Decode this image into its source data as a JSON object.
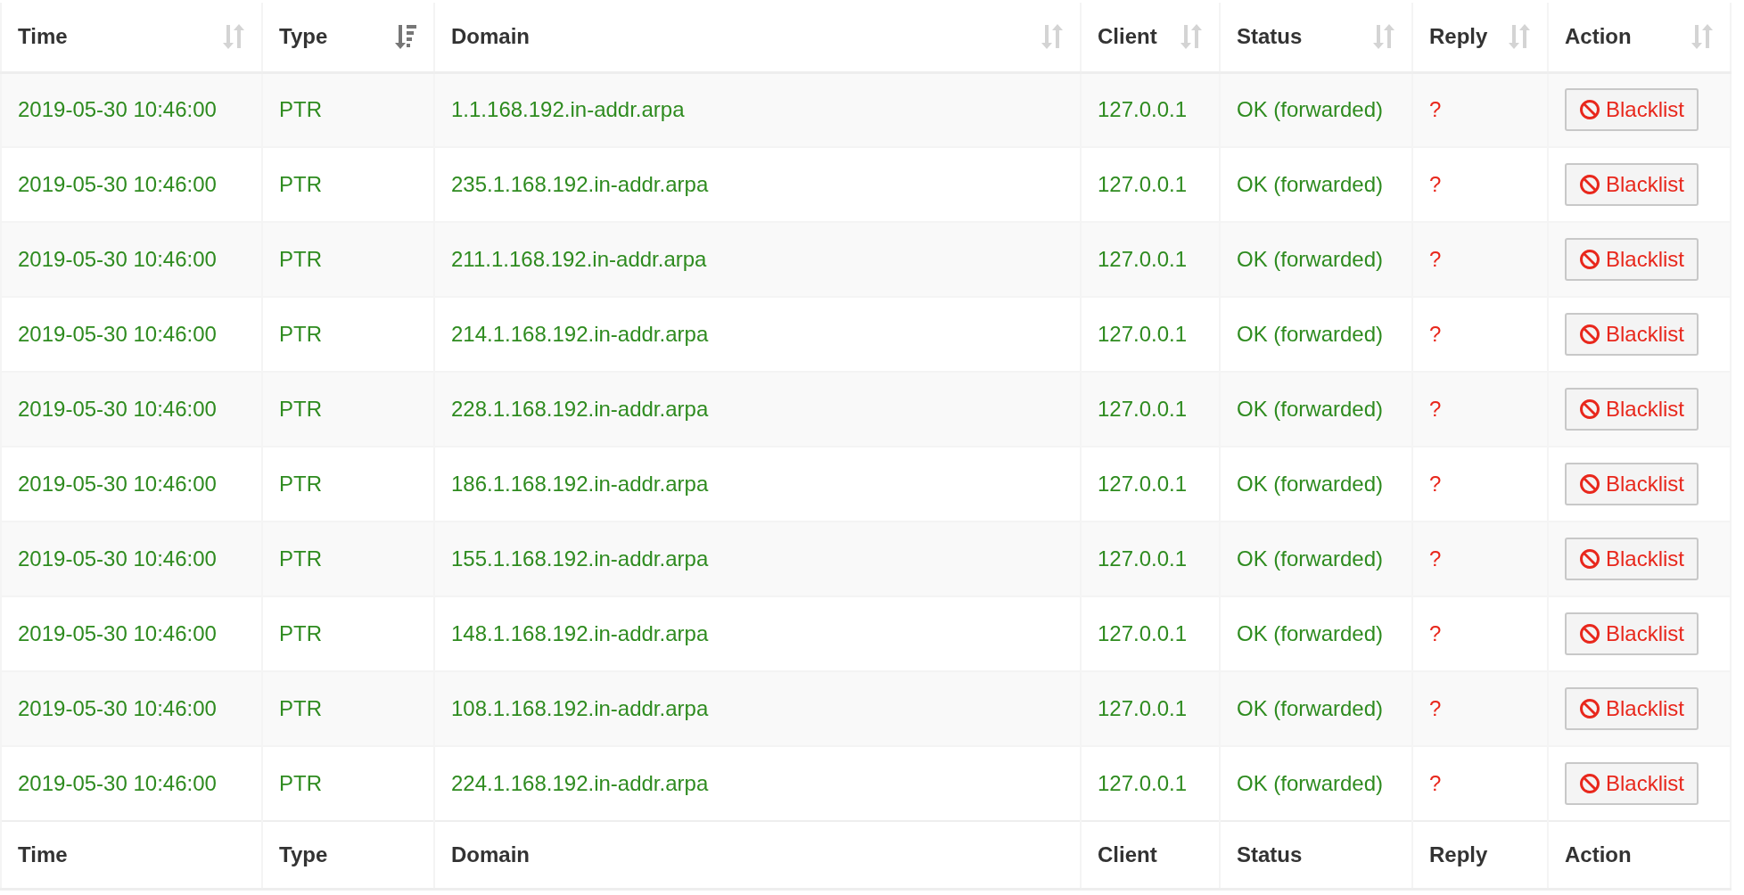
{
  "columns": [
    {
      "label": "Time",
      "sorted": false
    },
    {
      "label": "Type",
      "sorted": true
    },
    {
      "label": "Domain",
      "sorted": false
    },
    {
      "label": "Client",
      "sorted": false
    },
    {
      "label": "Status",
      "sorted": false
    },
    {
      "label": "Reply",
      "sorted": false
    },
    {
      "label": "Action",
      "sorted": false
    }
  ],
  "rows": [
    {
      "time": "2019-05-30 10:46:00",
      "type": "PTR",
      "domain": "1.1.168.192.in-addr.arpa",
      "client": "127.0.0.1",
      "status": "OK (forwarded)",
      "reply": "?",
      "action": "Blacklist"
    },
    {
      "time": "2019-05-30 10:46:00",
      "type": "PTR",
      "domain": "235.1.168.192.in-addr.arpa",
      "client": "127.0.0.1",
      "status": "OK (forwarded)",
      "reply": "?",
      "action": "Blacklist"
    },
    {
      "time": "2019-05-30 10:46:00",
      "type": "PTR",
      "domain": "211.1.168.192.in-addr.arpa",
      "client": "127.0.0.1",
      "status": "OK (forwarded)",
      "reply": "?",
      "action": "Blacklist"
    },
    {
      "time": "2019-05-30 10:46:00",
      "type": "PTR",
      "domain": "214.1.168.192.in-addr.arpa",
      "client": "127.0.0.1",
      "status": "OK (forwarded)",
      "reply": "?",
      "action": "Blacklist"
    },
    {
      "time": "2019-05-30 10:46:00",
      "type": "PTR",
      "domain": "228.1.168.192.in-addr.arpa",
      "client": "127.0.0.1",
      "status": "OK (forwarded)",
      "reply": "?",
      "action": "Blacklist"
    },
    {
      "time": "2019-05-30 10:46:00",
      "type": "PTR",
      "domain": "186.1.168.192.in-addr.arpa",
      "client": "127.0.0.1",
      "status": "OK (forwarded)",
      "reply": "?",
      "action": "Blacklist"
    },
    {
      "time": "2019-05-30 10:46:00",
      "type": "PTR",
      "domain": "155.1.168.192.in-addr.arpa",
      "client": "127.0.0.1",
      "status": "OK (forwarded)",
      "reply": "?",
      "action": "Blacklist"
    },
    {
      "time": "2019-05-30 10:46:00",
      "type": "PTR",
      "domain": "148.1.168.192.in-addr.arpa",
      "client": "127.0.0.1",
      "status": "OK (forwarded)",
      "reply": "?",
      "action": "Blacklist"
    },
    {
      "time": "2019-05-30 10:46:00",
      "type": "PTR",
      "domain": "108.1.168.192.in-addr.arpa",
      "client": "127.0.0.1",
      "status": "OK (forwarded)",
      "reply": "?",
      "action": "Blacklist"
    },
    {
      "time": "2019-05-30 10:46:00",
      "type": "PTR",
      "domain": "224.1.168.192.in-addr.arpa",
      "client": "127.0.0.1",
      "status": "OK (forwarded)",
      "reply": "?",
      "action": "Blacklist"
    }
  ],
  "footer": [
    "Time",
    "Type",
    "Domain",
    "Client",
    "Status",
    "Reply",
    "Action"
  ]
}
